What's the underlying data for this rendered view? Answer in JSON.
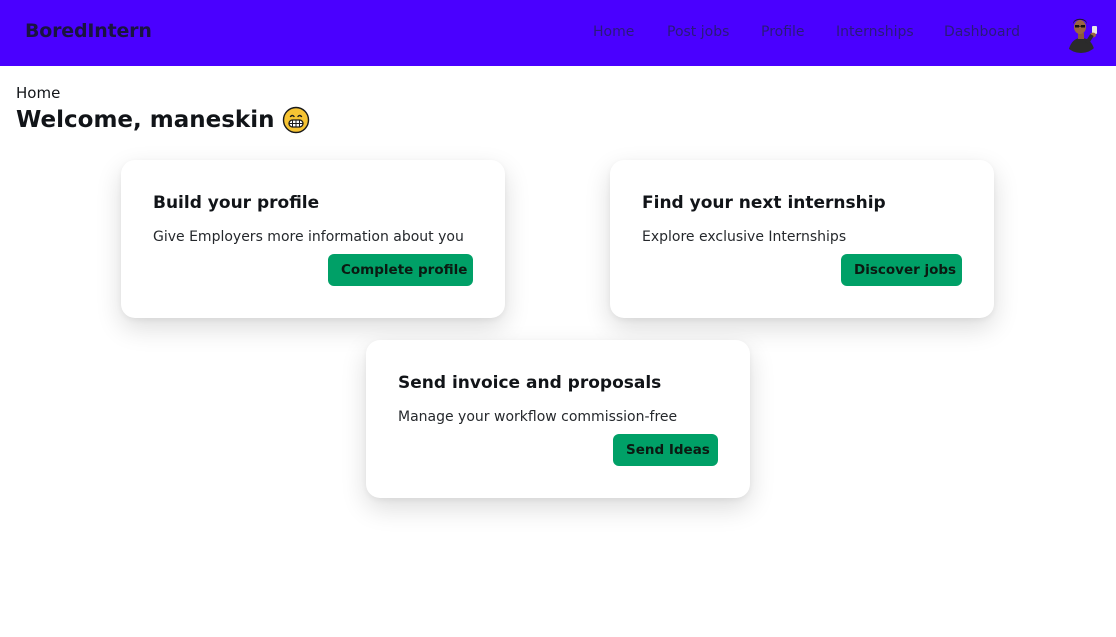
{
  "navbar": {
    "brand": "BoredIntern",
    "links": [
      "Home",
      "Post jobs",
      "Profile",
      "Internships",
      "Dashboard"
    ],
    "avatar_icon": "user-avatar-icon"
  },
  "colors": {
    "navbar_bg": "#4a00ff",
    "button_bg": "#00a067",
    "nav_link": "#2a1a7a"
  },
  "breadcrumb": "Home",
  "welcome": {
    "title": "Welcome, maneskin",
    "emoji_icon": "grinning-face-icon"
  },
  "cards": [
    {
      "title": "Build your profile",
      "description": "Give Employers more information about you",
      "button": "Complete profile"
    },
    {
      "title": "Find your next internship",
      "description": "Explore exclusive Internships",
      "button": "Discover jobs"
    },
    {
      "title": "Send invoice and proposals",
      "description": "Manage your workflow commission-free",
      "button": "Send Ideas"
    }
  ]
}
